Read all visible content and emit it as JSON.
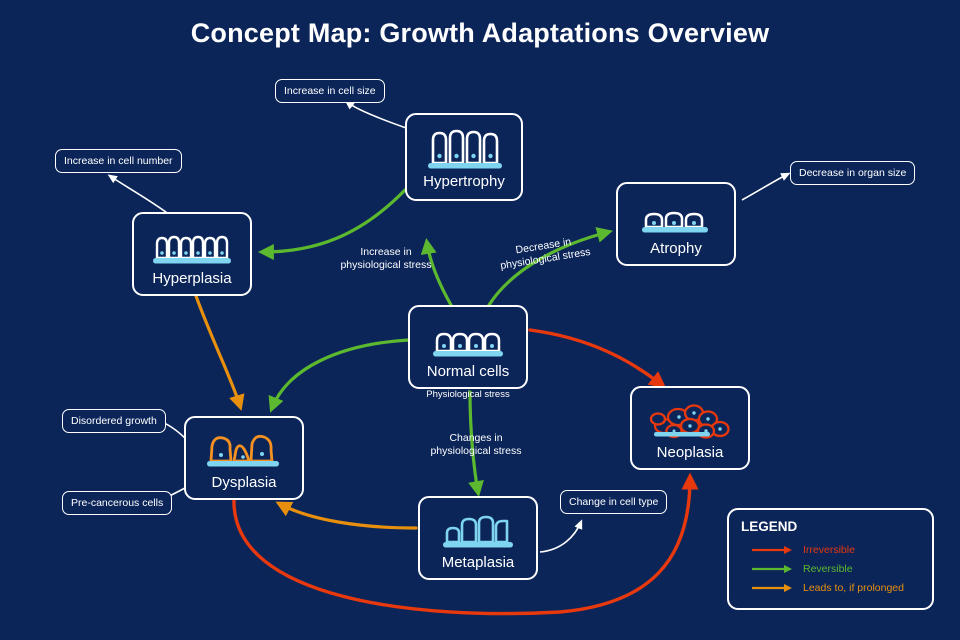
{
  "title": "Concept Map: Growth Adaptations Overview",
  "colors": {
    "background": "#0b2559",
    "node_border": "#ffffff",
    "text": "#ffffff",
    "irreversible": "#e8380d",
    "reversible": "#5cb82e",
    "prolonged": "#e8900d",
    "cell_blue": "#7fd4f0",
    "cell_white": "#ffffff",
    "cell_orange": "#f59120",
    "cell_red": "#e8380d"
  },
  "nodes": [
    {
      "id": "hypertrophy",
      "label": "Hypertrophy",
      "icon": "tall-columnar-cells-icon"
    },
    {
      "id": "hyperplasia",
      "label": "Hyperplasia",
      "icon": "many-cells-icon"
    },
    {
      "id": "atrophy",
      "label": "Atrophy",
      "icon": "shrunken-cells-icon"
    },
    {
      "id": "normal",
      "label": "Normal cells",
      "icon": "normal-cells-icon"
    },
    {
      "id": "dysplasia",
      "label": "Dysplasia",
      "icon": "irregular-cells-icon"
    },
    {
      "id": "metaplasia",
      "label": "Metaplasia",
      "icon": "varied-cells-icon"
    },
    {
      "id": "neoplasia",
      "label": "Neoplasia",
      "icon": "disorganized-tumor-cells-icon"
    }
  ],
  "callouts": [
    {
      "id": "cell-size",
      "text": "Increase in cell size"
    },
    {
      "id": "cell-number",
      "text": "Increase in cell number"
    },
    {
      "id": "organ-size",
      "text": "Decrease in organ size"
    },
    {
      "id": "disordered",
      "text": "Disordered growth"
    },
    {
      "id": "precancerous",
      "text": "Pre-cancerous cells"
    },
    {
      "id": "cell-type",
      "text": "Change in cell type"
    }
  ],
  "edge_labels": [
    {
      "id": "increase-stress",
      "text": "Increase in\nphysiological stress"
    },
    {
      "id": "decrease-stress",
      "text": "Decrease in\nphysiological stress"
    },
    {
      "id": "changes-stress",
      "text": "Changes in\nphysiological stress"
    }
  ],
  "sublabels": [
    {
      "id": "normal-sub",
      "text": "Physiological stress"
    }
  ],
  "legend": {
    "title": "LEGEND",
    "items": [
      {
        "id": "irreversible",
        "label": "Irreversible",
        "color": "#e8380d"
      },
      {
        "id": "reversible",
        "label": "Reversible",
        "color": "#5cb82e"
      },
      {
        "id": "prolonged",
        "label": "Leads to, if prolonged",
        "color": "#e8900d"
      }
    ]
  },
  "edges": [
    {
      "from": "normal",
      "to": "hypertrophy",
      "type": "reversible"
    },
    {
      "from": "normal",
      "to": "atrophy",
      "type": "reversible"
    },
    {
      "from": "hypertrophy",
      "to": "hyperplasia",
      "type": "reversible"
    },
    {
      "from": "normal",
      "to": "dysplasia",
      "type": "reversible"
    },
    {
      "from": "normal",
      "to": "metaplasia",
      "type": "reversible"
    },
    {
      "from": "normal",
      "to": "neoplasia",
      "type": "irreversible"
    },
    {
      "from": "hyperplasia",
      "to": "dysplasia",
      "type": "prolonged"
    },
    {
      "from": "metaplasia",
      "to": "dysplasia",
      "type": "prolonged"
    },
    {
      "from": "dysplasia",
      "to": "neoplasia",
      "type": "irreversible"
    }
  ]
}
